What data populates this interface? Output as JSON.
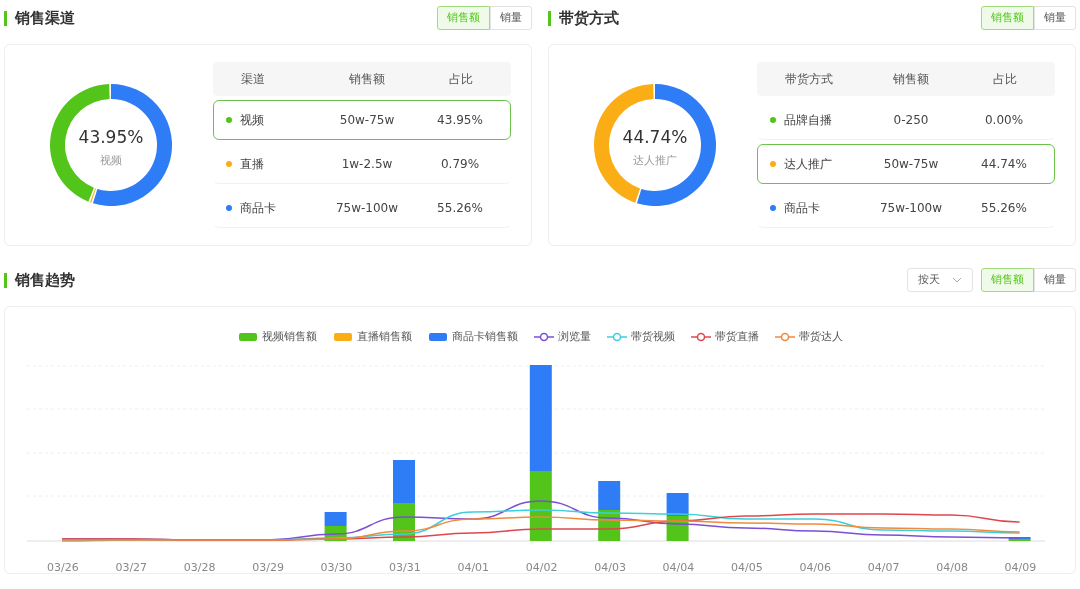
{
  "panels": [
    {
      "title": "销售渠道",
      "toggle": [
        {
          "label": "销售额",
          "selected": true
        },
        {
          "label": "销量",
          "selected": false
        }
      ],
      "donut": {
        "value": "43.95%",
        "label": "视频",
        "chart_data": {
          "type": "donut",
          "values": [
            43.95,
            0.79,
            55.26
          ]
        }
      },
      "table": {
        "columns": [
          "渠道",
          "销售额",
          "占比"
        ],
        "rows": [
          {
            "name": "视频",
            "sales": "50w-75w",
            "share": "43.95%",
            "color": "#52c41a",
            "selected": true
          },
          {
            "name": "直播",
            "sales": "1w-2.5w",
            "share": "0.79%",
            "color": "#faad14",
            "selected": false
          },
          {
            "name": "商品卡",
            "sales": "75w-100w",
            "share": "55.26%",
            "color": "#2f7df6",
            "selected": false
          }
        ]
      }
    },
    {
      "title": "带货方式",
      "toggle": [
        {
          "label": "销售额",
          "selected": true
        },
        {
          "label": "销量",
          "selected": false
        }
      ],
      "donut": {
        "value": "44.74%",
        "label": "达人推广",
        "chart_data": {
          "type": "donut",
          "values": [
            0.0,
            44.74,
            55.26
          ]
        }
      },
      "table": {
        "columns": [
          "带货方式",
          "销售额",
          "占比"
        ],
        "rows": [
          {
            "name": "品牌自播",
            "sales": "0-250",
            "share": "0.00%",
            "color": "#52c41a",
            "selected": false
          },
          {
            "name": "达人推广",
            "sales": "50w-75w",
            "share": "44.74%",
            "color": "#faad14",
            "selected": true
          },
          {
            "name": "商品卡",
            "sales": "75w-100w",
            "share": "55.26%",
            "color": "#2f7df6",
            "selected": false
          }
        ]
      }
    }
  ],
  "trend": {
    "title": "销售趋势",
    "period": "按天",
    "toggle": [
      {
        "label": "销售额",
        "selected": true
      },
      {
        "label": "销量",
        "selected": false
      }
    ],
    "legend": [
      {
        "label": "视频销售额",
        "kind": "bar",
        "color": "#52c41a"
      },
      {
        "label": "直播销售额",
        "kind": "bar",
        "color": "#faad14"
      },
      {
        "label": "商品卡销售额",
        "kind": "bar",
        "color": "#2f7df6"
      },
      {
        "label": "浏览量",
        "kind": "line",
        "color": "#7b4fd6"
      },
      {
        "label": "带货视频",
        "kind": "line",
        "color": "#3ccfdc"
      },
      {
        "label": "带货直播",
        "kind": "line",
        "color": "#e0474c"
      },
      {
        "label": "带货达人",
        "kind": "line",
        "color": "#f08a3c"
      }
    ],
    "x_labels": [
      "03/26",
      "03/27",
      "03/28",
      "03/29",
      "03/30",
      "03/31",
      "04/01",
      "04/02",
      "04/03",
      "04/04",
      "04/05",
      "04/06",
      "04/07",
      "04/08",
      "04/09"
    ]
  }
}
